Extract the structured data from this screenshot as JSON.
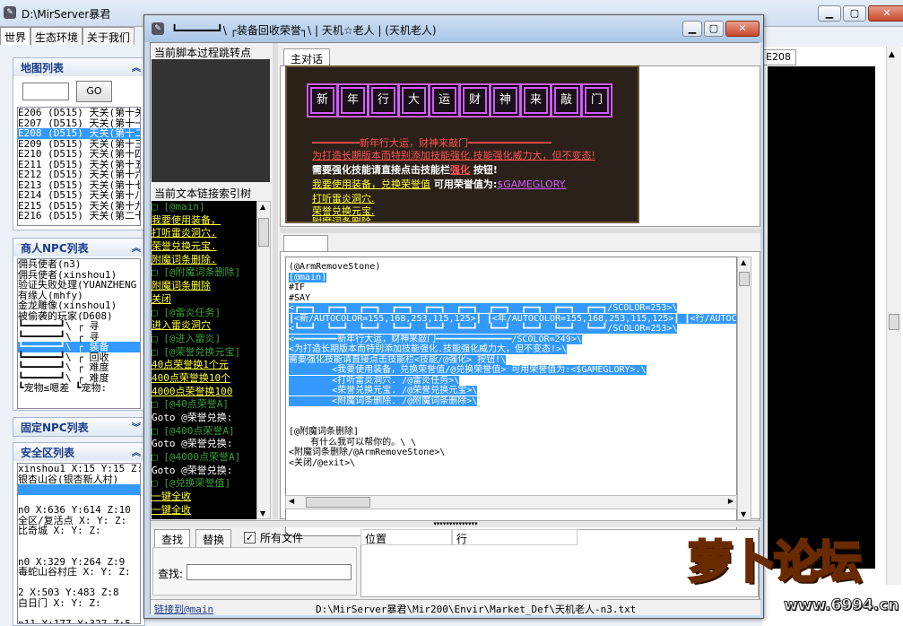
{
  "main_window": {
    "title": "D:\\MirServer暴君",
    "tabs": [
      "世界",
      "生态环境",
      "关于我们"
    ]
  },
  "map_panel": {
    "title": "地图列表",
    "go_label": "GO",
    "search_value": "",
    "items": [
      "E206 (D515) 天关(第十关",
      "E207 (D515) 天关(第十一",
      "E208 (D515) 天关(第十二",
      "E209 (D515) 天关(第十三",
      "E210 (D515) 天关(第十四",
      "E211 (D515) 天关(第十五",
      "E212 (D515) 天关(第十六",
      "E213 (D515) 天关(第十七",
      "E214 (D515) 天关(第十八",
      "E215 (D515) 天关(第十九",
      "E216 (D515) 天关(第二十"
    ],
    "selected_index": 2
  },
  "npc_panel": {
    "title": "商人NPC列表",
    "items": [
      "佣兵使者(n3)",
      "佣兵使者(xinshou1)",
      "验证失败处理(YUANZHENG",
      "有缘人(mhfy)",
      "金龙雕像(xinshou1)",
      "被偷袭的玩家(D608)",
      "┗━━━━━━┛\\ ┌ 寻",
      "┗━━━━━━┛\\ ┌ 寻",
      "┗━━━━━━┛\\ ┌ 装备",
      "┗━━━━━━┛\\ ┌ 回收",
      "┗━━━━━━┛\\ ┌ 难度",
      "┗━━━━━━┛\\ ┌ 难度",
      "┗宠物≤嗯差 ┗宠物:"
    ],
    "selected_index": 8
  },
  "fixed_npc_panel": {
    "title": "固定NPC列表"
  },
  "safe_panel": {
    "title": "安全区列表",
    "items": [
      "xinshou1 X:15 Y:15 Z:",
      "银杏山谷(银杏新人村)",
      "",
      "",
      " n0 X:636 Y:614 Z:10",
      "全区/复活点 X: Y: Z:",
      "比奇城 X: Y: Z:",
      "",
      "",
      " n0 X:329 Y:264 Z:9",
      "毒蛇山谷村庄 X: Y: Z:",
      "",
      " 2 X:503 Y:483 Z:8",
      "白日门 X: Y: Z:",
      "",
      " n11 X:177 Y:327 Z:5"
    ],
    "selected_index": 2
  },
  "right_panel": {
    "tab_label": "E208"
  },
  "dialog": {
    "title": "┗━━━━━━┛\\ ┌装备回收荣誉┐\\ | 天机☆老人 |  (天机老人)",
    "jump_label": "当前脚本过程跳转点",
    "index_label": "当前文本链接索引树",
    "tree": [
      {
        "t": "□ [@main]",
        "c": "g"
      },
      {
        "t": "  我要使用装备，",
        "c": "y"
      },
      {
        "t": "  打听雷炎洞穴.",
        "c": "y"
      },
      {
        "t": "  荣誉兑换元宝.",
        "c": "y"
      },
      {
        "t": "  附魔词条删除.",
        "c": "y"
      },
      {
        "t": "□ [@附魔词条删除]",
        "c": "g"
      },
      {
        "t": "  附魔词条删除",
        "c": "y"
      },
      {
        "t": "  关闭",
        "c": "y"
      },
      {
        "t": "□ [@雷炎任务]",
        "c": "g"
      },
      {
        "t": "  进入雷炎洞穴",
        "c": "y"
      },
      {
        "t": "□ [@进入雷炎]",
        "c": "g"
      },
      {
        "t": "□ [@荣誉兑换元宝]",
        "c": "g"
      },
      {
        "t": "  40点荣誉换1个元",
        "c": "y"
      },
      {
        "t": "  400点荣誉换10个",
        "c": "y"
      },
      {
        "t": "  4000点荣誉换100",
        "c": "y"
      },
      {
        "t": "□ [@40点荣誉A]",
        "c": "g"
      },
      {
        "t": "  Goto @荣誉兑换:",
        "c": "w"
      },
      {
        "t": "□ [@400点荣誉A]",
        "c": "g"
      },
      {
        "t": "  Goto @荣誉兑换:",
        "c": "w"
      },
      {
        "t": "□ [@4000点荣誉A]",
        "c": "g"
      },
      {
        "t": "  Goto @荣誉兑换:",
        "c": "w"
      },
      {
        "t": "□ [@兑换荣誉值]",
        "c": "g"
      },
      {
        "t": "  一键全收",
        "c": "y"
      },
      {
        "t": "  一键全收",
        "c": "y"
      }
    ],
    "main_tab": "主对话",
    "banner": {
      "chars": [
        "新",
        "年",
        "行",
        "大",
        "运",
        "财",
        "神",
        "来",
        "敲",
        "门"
      ],
      "line1": "━━━━━━━━新年行大运，财神来敲门━━━━━━━━━━━━━━",
      "line2": "为打造长期版本而特别添加技能强化.技能强化威力大，但不变态!",
      "line3a": "需要强化技能请直接点击技能栏",
      "line3b": "强化",
      "line3c": " 按钮!",
      "line4a": "我要使用装备，兑换荣誉值",
      "line4b": " 可用荣誉值为:",
      "line4c": "$GAMEGLORY.",
      "line5": "打听雷炎洞穴.",
      "line6": "荣誉兑换元宝.",
      "line7": "附魔词条删除."
    },
    "code_lines": [
      {
        "t": "(@ArmRemoveStone)",
        "hl": false
      },
      {
        "t": "[@main]",
        "hl": true
      },
      {
        "t": "#IF",
        "hl": false
      },
      {
        "t": "#SAY",
        "hl": false
      },
      {
        "t": "<┏━━┓  ┏━━┓  ┏━━┓  ┏━━┓  ┏━━┓  ┏━━┓  ┏━━┓  ┏━━┓  ┏━━┓  ┏━━┓/SCOLOR=253>\\",
        "hl": true
      },
      {
        "t": "┃<新/AUTOCOLOR=155,168,253,115,125>┃ ┃<年/AUTOCOLOR=155,168,253,115,125>┃ ┃<行/AUTOC",
        "hl": true
      },
      {
        "t": "<┗━━┛  ┗━━┛  ┗━━┛  ┗━━┛  ┗━━┛  ┗━━┛  ┗━━┛  ┗━━┛  ┗━━┛  ┗━━┛/SCOLOR=253>\\",
        "hl": true
      },
      {
        "t": "<━━━━━━━━新年行大运，财神来敲门━━━━━━━━━━━━━━/SCOLOR=249>\\",
        "hl": true
      },
      {
        "t": "<为打造长期版本而特别添加技能强化.技能强化威力大，但不变态!>\\",
        "hl": true
      },
      {
        "t": "需要强化技能请直接点击技能栏<技能/@强化> 按钮!\\",
        "hl": true
      },
      {
        "t": "        <我要使用装备，兑换荣誉值/@兑换荣誉值> 可用荣誉值为:<$GAMEGLORY>.\\",
        "hl": true
      },
      {
        "t": "        <打听雷炎洞穴. /@雷炎任务>\\",
        "hl": true
      },
      {
        "t": "        <荣誉兑换元宝. /@荣誉兑换元宝>\\",
        "hl": true
      },
      {
        "t": "        <附魔词条删除. /@附魔词条删除>\\",
        "hl": true
      },
      {
        "t": "",
        "hl": false
      },
      {
        "t": "",
        "hl": false
      },
      {
        "t": "[@附魔词条删除]",
        "hl": false
      },
      {
        "t": "    有什么我可以帮你的。\\ \\",
        "hl": false
      },
      {
        "t": "<附魔词条删除/@ArmRemoveStone>\\",
        "hl": false
      },
      {
        "t": "<关闭/@exit>\\",
        "hl": false
      }
    ],
    "find_tab": "查找",
    "replace_tab": "替换",
    "all_files_label": "所有文件",
    "all_files_checked": true,
    "find_label": "查找:",
    "find_value": "",
    "col_position": "位置",
    "col_line": "行",
    "link_status": "链接到@main",
    "path_status": "D:\\MirServer暴君\\Mir200\\Envir\\Market_Def\\天机老人-n3.txt"
  },
  "watermark": {
    "logo_text": "萝卜论坛",
    "url": "www.6994.cn"
  }
}
